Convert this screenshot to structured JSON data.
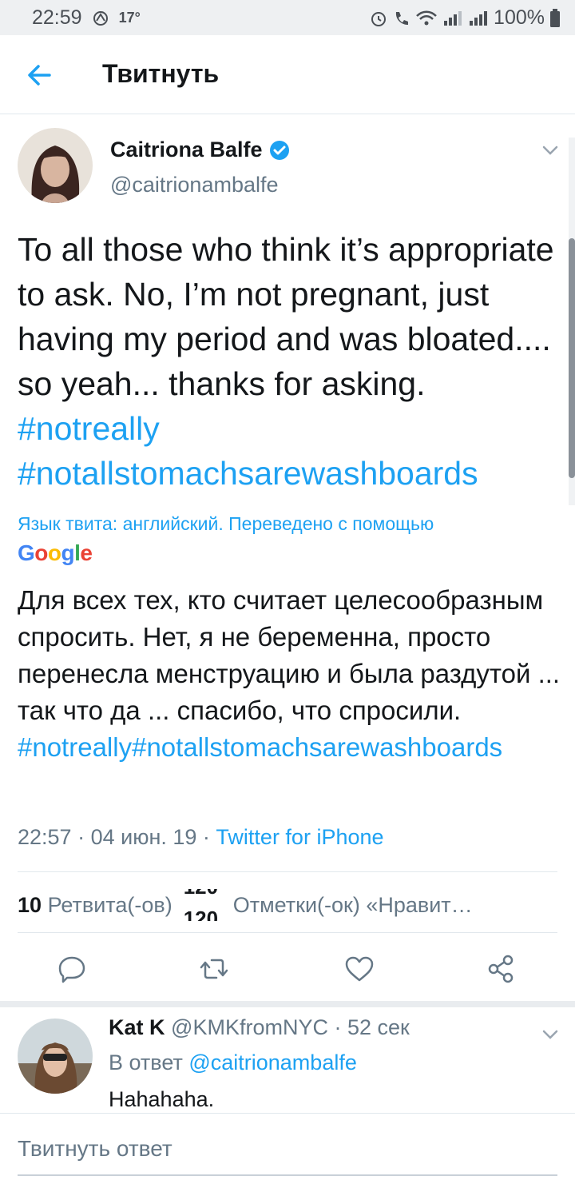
{
  "status_bar": {
    "time": "22:59",
    "temperature": "17°",
    "battery": "100%"
  },
  "header": {
    "title": "Твитнуть"
  },
  "tweet": {
    "author_name": "Caitriona Balfe",
    "author_handle": "@caitrionambalfe",
    "verified": true,
    "text_plain": "To all those who think it’s appropriate to ask. No, I’m not pregnant, just having my period and was bloated.... so yeah... thanks for asking.",
    "hashtag_1": "#notreally",
    "hashtag_2": "#notallstomachsarewashboards",
    "translation_note": "Язык твита: английский. Переведено с помощью",
    "translation_provider": "Google",
    "translated_plain": "Для всех тех, кто считает целесообразным спросить. Нет, я не беременна, просто перенесла менструацию и была раздутой ... так что да ... спасибо, что спросили.",
    "translated_hashtags": "#notreally#notallstomachsarewashboards",
    "time": "22:57",
    "date": "04 июн. 19",
    "source": "Twitter for iPhone",
    "retweet_count": "10",
    "retweet_label": "Ретвита(-ов)",
    "likes_count_partial": "120",
    "likes_label": "Отметки(-ок) «Нравит…"
  },
  "reply": {
    "author_name": "Kat K",
    "author_handle": "@KMKfromNYC",
    "age": "52 сек",
    "in_reply_label": "В ответ",
    "in_reply_handle": "@caitrionambalfe",
    "text": "Hahahaha."
  },
  "composer": {
    "placeholder": "Твитнуть ответ"
  },
  "colors": {
    "accent": "#1da1f2",
    "secondary_text": "#657786",
    "primary_text": "#14171a"
  }
}
